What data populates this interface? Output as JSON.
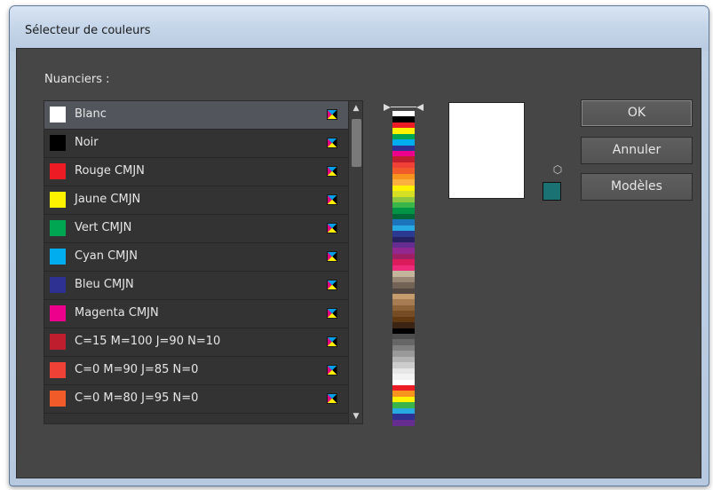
{
  "window": {
    "title": "Sélecteur de couleurs"
  },
  "swatches": {
    "label": "Nuanciers :",
    "items": [
      {
        "label": "Blanc",
        "color": "#ffffff",
        "selected": true
      },
      {
        "label": "Noir",
        "color": "#000000"
      },
      {
        "label": "Rouge CMJN",
        "color": "#ed1c24"
      },
      {
        "label": "Jaune CMJN",
        "color": "#fff200"
      },
      {
        "label": "Vert CMJN",
        "color": "#00a651"
      },
      {
        "label": "Cyan CMJN",
        "color": "#00aeef"
      },
      {
        "label": "Bleu CMJN",
        "color": "#2e3192"
      },
      {
        "label": "Magenta CMJN",
        "color": "#ec008c"
      },
      {
        "label": "C=15 M=100 J=90 N=10",
        "color": "#be1e2d"
      },
      {
        "label": "C=0 M=90 J=85 N=0",
        "color": "#ef4136"
      },
      {
        "label": "C=0 M=80 J=95 N=0",
        "color": "#f15a29"
      }
    ],
    "process_icon": "cmyk-process-icon"
  },
  "spectrum": {
    "colors": [
      "#ffffff",
      "#000000",
      "#ed1c24",
      "#fff200",
      "#00a651",
      "#00aeef",
      "#2e3192",
      "#ec008c",
      "#be1e2d",
      "#ef4136",
      "#f15a29",
      "#f7941d",
      "#fbb040",
      "#fff200",
      "#d7df23",
      "#8dc63f",
      "#39b54a",
      "#009444",
      "#006838",
      "#1c75bc",
      "#27aae1",
      "#2b3990",
      "#262262",
      "#662d91",
      "#92278f",
      "#9e1f63",
      "#da1c5c",
      "#ee2a7b",
      "#c2b59b",
      "#998675",
      "#736357",
      "#534741",
      "#c69c6d",
      "#a67c52",
      "#8c6239",
      "#754c24",
      "#603913",
      "#3c2415",
      "#000000",
      "#4d4d4d",
      "#666666",
      "#808080",
      "#999999",
      "#b3b3b3",
      "#cccccc",
      "#e6e6e6",
      "#f2f2f2",
      "#ffffff",
      "#ed1c24",
      "#f7941d",
      "#fff200",
      "#39b54a",
      "#27aae1",
      "#2e3192",
      "#662d91"
    ]
  },
  "preview": {
    "color": "#ffffff"
  },
  "web_safe": {
    "icon": "cube-icon",
    "color": "#1b7272"
  },
  "buttons": {
    "ok": "OK",
    "cancel": "Annuler",
    "models": "Modèles"
  }
}
